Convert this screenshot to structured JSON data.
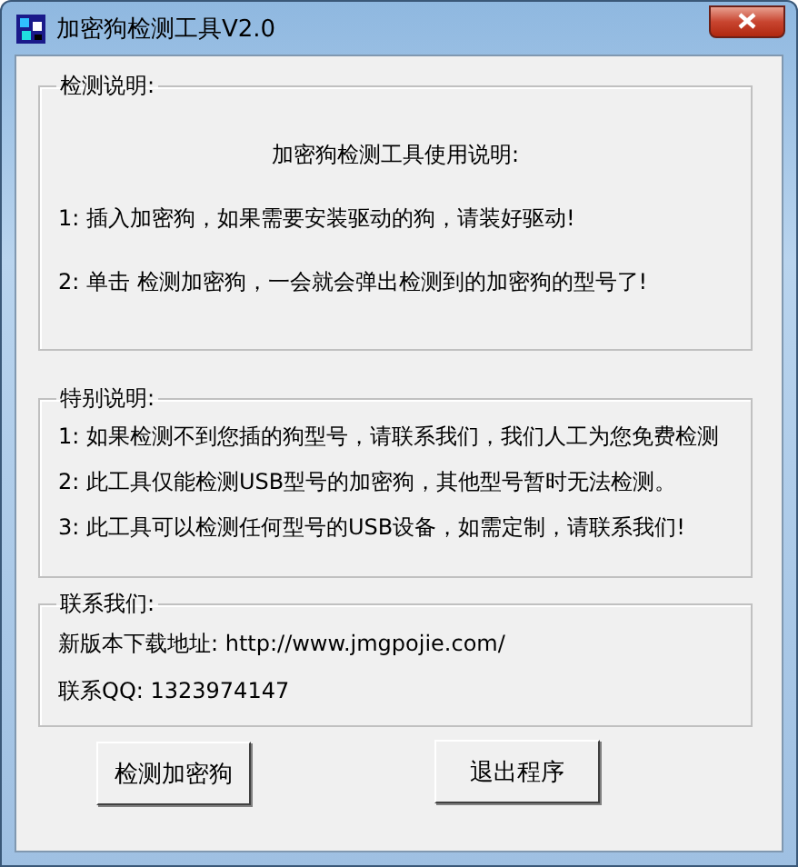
{
  "window": {
    "title": "加密狗检测工具V2.0"
  },
  "sections": [
    {
      "legend": "检测说明:",
      "lines": [
        {
          "kind": "heading",
          "text": "加密狗检测工具使用说明:"
        },
        {
          "kind": "item",
          "text": "1: 插入加密狗，如果需要安装驱动的狗，请装好驱动!"
        },
        {
          "kind": "item",
          "text": "2: 单击 检测加密狗，一会就会弹出检测到的加密狗的型号了!"
        }
      ]
    },
    {
      "legend": "特别说明:",
      "lines": [
        {
          "kind": "item",
          "text": "1: 如果检测不到您插的狗型号，请联系我们，我们人工为您免费检测"
        },
        {
          "kind": "item",
          "text": "2: 此工具仅能检测USB型号的加密狗，其他型号暂时无法检测。"
        },
        {
          "kind": "item",
          "text": "3: 此工具可以检测任何型号的USB设备，如需定制，请联系我们!"
        }
      ]
    },
    {
      "legend": "联系我们:",
      "lines": [
        {
          "kind": "item",
          "text": "新版本下载地址: http://www.jmgpojie.com/"
        },
        {
          "kind": "item",
          "text": "联系QQ: 1323974147"
        }
      ]
    }
  ],
  "buttons": [
    "检测加密狗",
    "退出程序"
  ]
}
